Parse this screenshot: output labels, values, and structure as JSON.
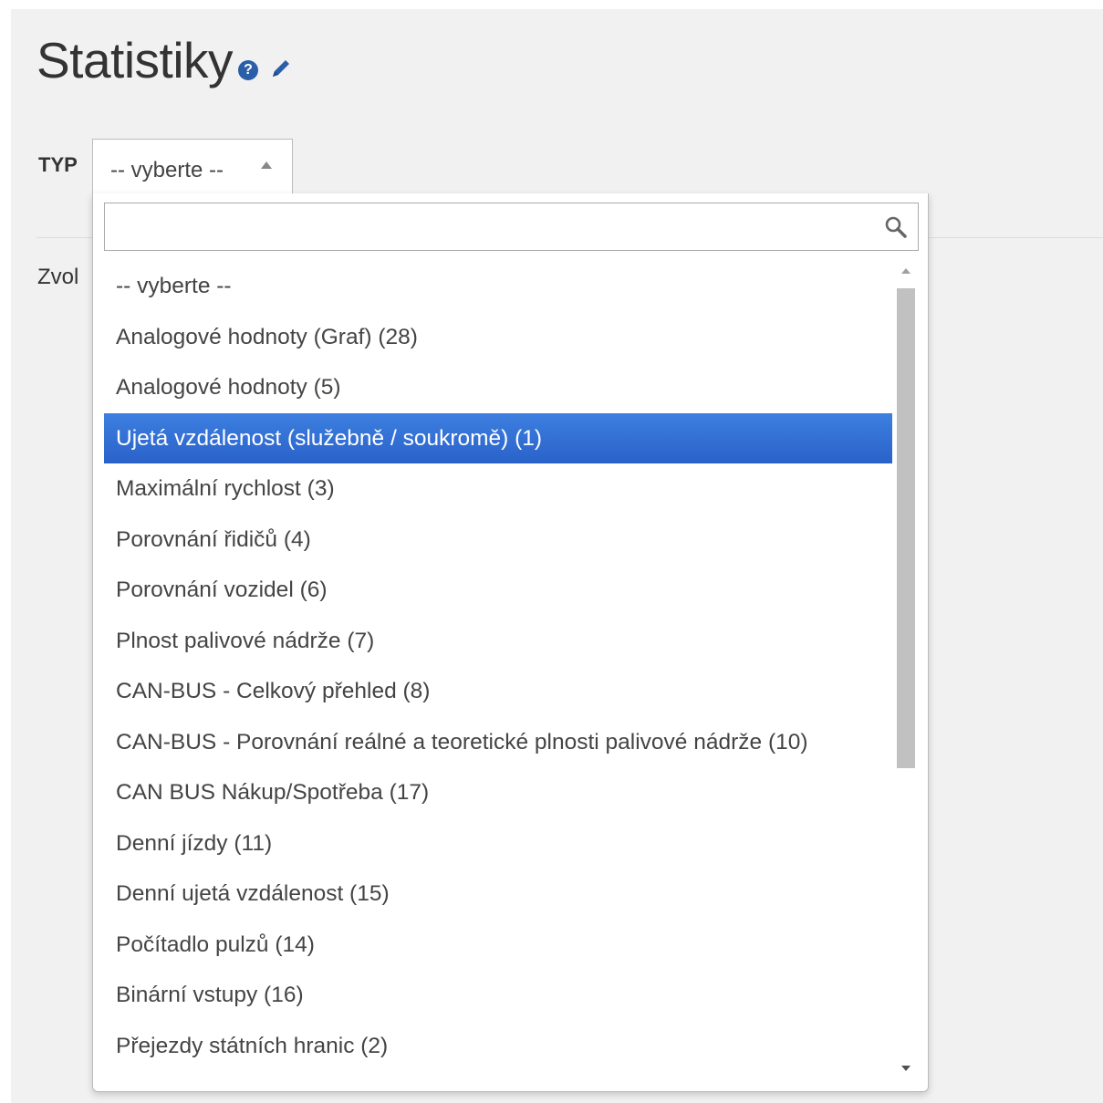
{
  "header": {
    "title": "Statistiky",
    "help_icon": "question-circle-icon",
    "edit_icon": "pencil-icon",
    "help_glyph": "?"
  },
  "form": {
    "type_label": "TYP",
    "select_value": "-- vyberte --",
    "partial_text": "Zvol"
  },
  "dropdown": {
    "search": {
      "value": "",
      "placeholder": "",
      "icon": "search-icon"
    },
    "selected_index": 3,
    "selected_color": "#3875d7",
    "options": [
      "-- vyberte --",
      "Analogové hodnoty (Graf) (28)",
      "Analogové hodnoty (5)",
      "Ujetá vzdálenost (služebně / soukromě) (1)",
      "Maximální rychlost (3)",
      "Porovnání řidičů (4)",
      "Porovnání vozidel (6)",
      "Plnost palivové nádrže (7)",
      "CAN-BUS - Celkový přehled (8)",
      "CAN-BUS - Porovnání reálné a teoretické plnosti palivové nádrže (10)",
      "CAN BUS Nákup/Spotřeba (17)",
      "Denní jízdy (11)",
      "Denní ujetá vzdálenost (15)",
      "Počítadlo pulzů (14)",
      "Binární vstupy (16)",
      "Přejezdy státních hranic (2)"
    ]
  }
}
